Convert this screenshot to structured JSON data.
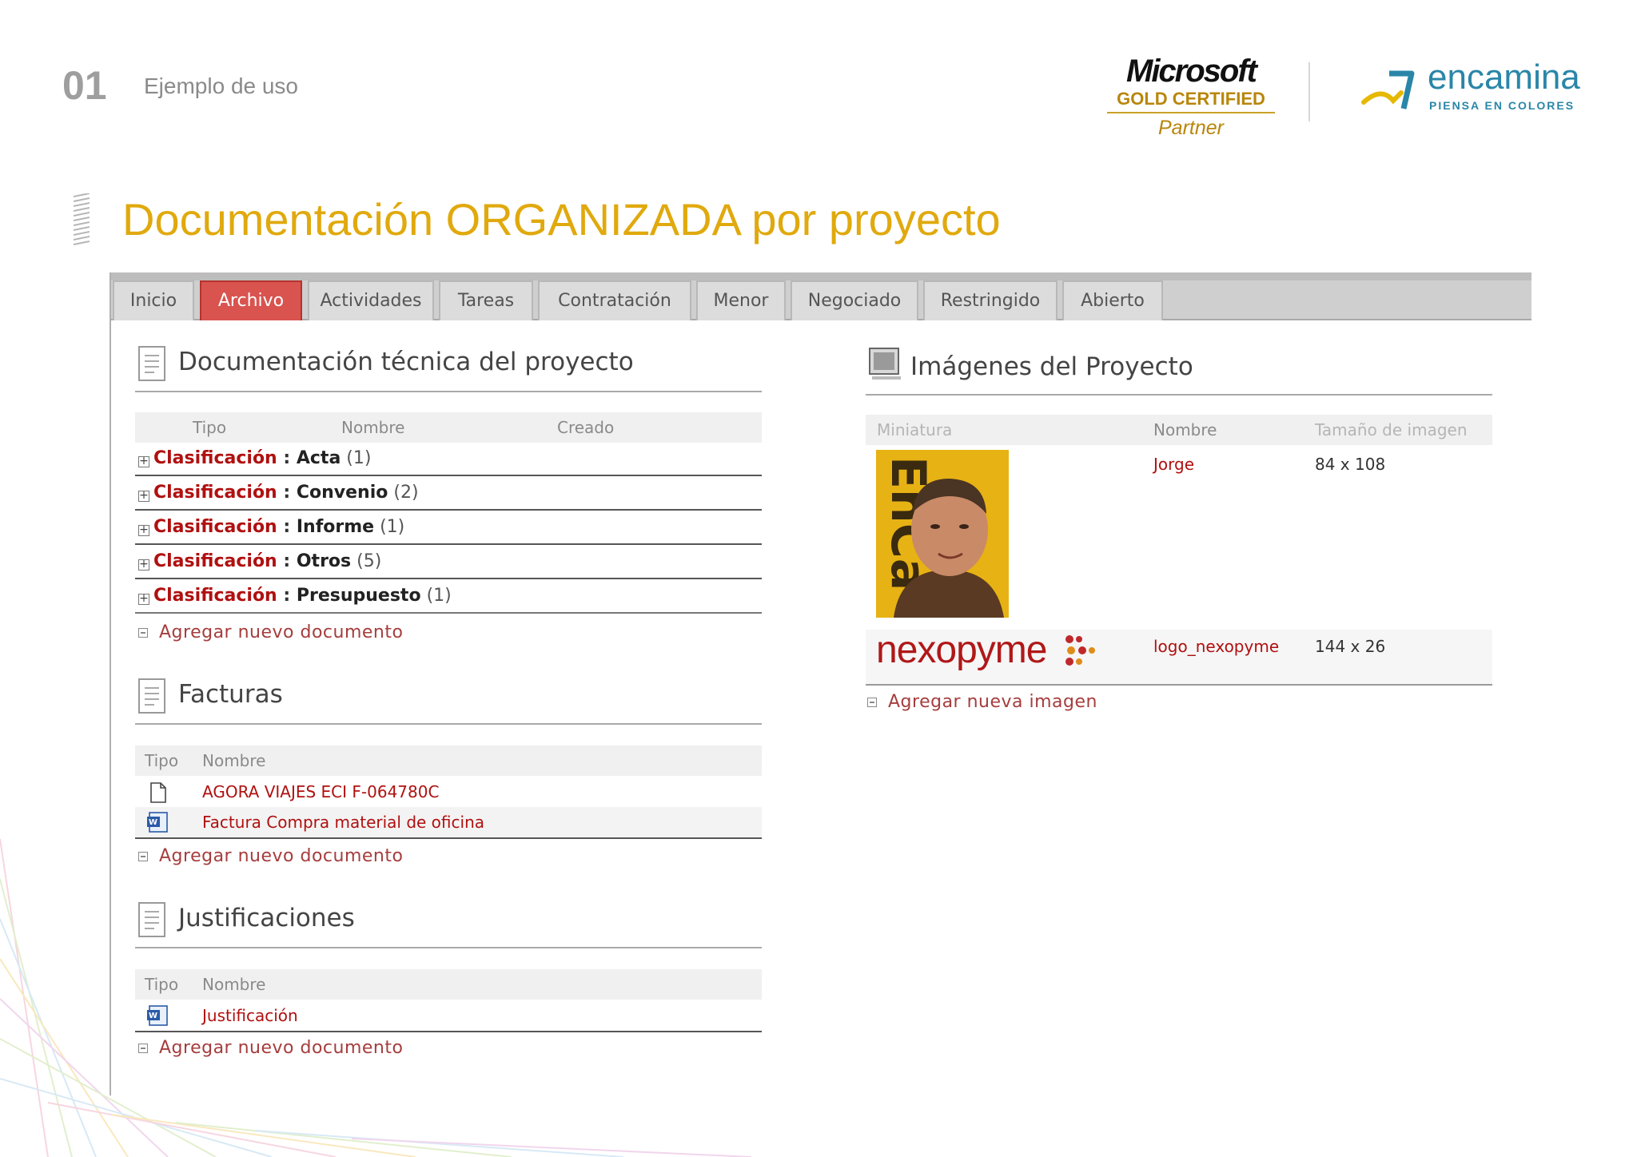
{
  "slide": {
    "number": "01",
    "subtitle": "Ejemplo de uso",
    "title": "Documentación ORGANIZADA por proyecto"
  },
  "logos": {
    "microsoft": {
      "word": "Microsoft",
      "gold": "GOLD CERTIFIED",
      "partner": "Partner"
    },
    "encamina": {
      "word": "encamina",
      "tagline": "PIENSA EN COLORES"
    }
  },
  "colors": {
    "accent_title": "#e0a90d",
    "tab_active": "#d9534f",
    "link": "#b01010",
    "encamina": "#2a86a8"
  },
  "tabs": [
    {
      "label": "Inicio",
      "active": false
    },
    {
      "label": "Archivo",
      "active": true
    },
    {
      "label": "Actividades",
      "active": false
    },
    {
      "label": "Tareas",
      "active": false
    },
    {
      "label": "Contratación",
      "active": false
    },
    {
      "label": "Menor",
      "active": false
    },
    {
      "label": "Negociado",
      "active": false
    },
    {
      "label": "Restringido",
      "active": false
    },
    {
      "label": "Abierto",
      "active": false
    }
  ],
  "doc_tecnica": {
    "title": "Documentación técnica del proyecto",
    "columns": [
      "Tipo",
      "Nombre",
      "Creado"
    ],
    "groups": [
      {
        "label": "Clasificación",
        "sep": " : ",
        "value": "Acta",
        "count": "(1)"
      },
      {
        "label": "Clasificación",
        "sep": " : ",
        "value": "Convenio",
        "count": "(2)"
      },
      {
        "label": "Clasificación",
        "sep": " : ",
        "value": "Informe",
        "count": "(1)"
      },
      {
        "label": "Clasificación",
        "sep": " : ",
        "value": "Otros",
        "count": "(5)"
      },
      {
        "label": "Clasificación",
        "sep": " : ",
        "value": "Presupuesto",
        "count": "(1)"
      }
    ],
    "add_label": "Agregar nuevo documento"
  },
  "facturas": {
    "title": "Facturas",
    "columns": [
      "Tipo",
      "Nombre"
    ],
    "items": [
      {
        "icon": "generic-file-icon",
        "name": "AGORA VIAJES ECI F-064780C"
      },
      {
        "icon": "word-doc-icon",
        "name": "Factura Compra material de oficina"
      }
    ],
    "add_label": "Agregar nuevo documento"
  },
  "justificaciones": {
    "title": "Justificaciones",
    "columns": [
      "Tipo",
      "Nombre"
    ],
    "items": [
      {
        "icon": "word-doc-icon",
        "name": "Justificación"
      }
    ],
    "add_label": "Agregar nuevo documento"
  },
  "imagenes": {
    "title": "Imágenes del Proyecto",
    "columns": [
      "Miniatura",
      "Nombre",
      "Tamaño de imagen"
    ],
    "items": [
      {
        "thumb": "portrait-photo",
        "name": "Jorge",
        "size": "84 x 108"
      },
      {
        "thumb": "nexopyme-logo",
        "thumb_text": "nexopyme",
        "name": "logo_nexopyme",
        "size": "144 x 26"
      }
    ],
    "add_label": "Agregar nueva imagen"
  }
}
